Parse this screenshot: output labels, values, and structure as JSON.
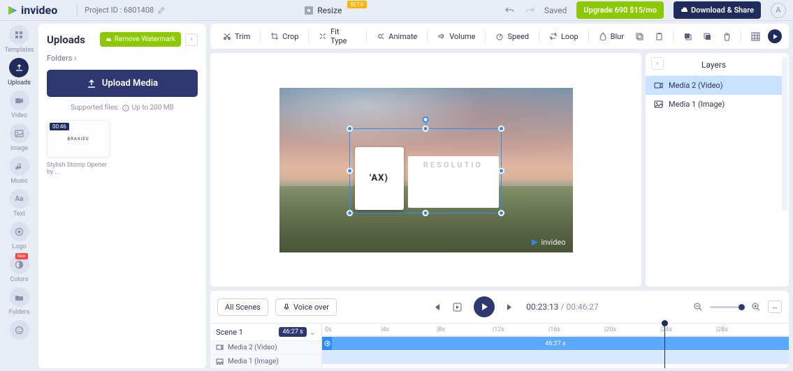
{
  "brand": "invideo",
  "project_id_label": "Project ID : 6801408",
  "resize_label": "Resize",
  "beta_label": "BETA",
  "saved_label": "Saved",
  "upgrade_label": "Upgrade 690 $15/mo",
  "download_label": "Download & Share",
  "avatar_initial": "A",
  "side_rail": [
    {
      "label": "Templates"
    },
    {
      "label": "Uploads"
    },
    {
      "label": "Video"
    },
    {
      "label": "Image"
    },
    {
      "label": "Music"
    },
    {
      "label": "Text"
    },
    {
      "label": "Logo"
    },
    {
      "label": "Colors"
    },
    {
      "label": "Folders"
    }
  ],
  "uploads_panel": {
    "title": "Uploads",
    "remove_wm": "Remove Watermark",
    "folders": "Folders ›",
    "upload_btn": "Upload Media",
    "supported_prefix": "Supported files:",
    "supported_limit": "Up to 200 MB",
    "thumb_duration": "00:46",
    "thumb_inner": "BRAXIEU",
    "thumb_caption": "Stylish Stomp Opener by ..."
  },
  "toolbar": {
    "trim": "Trim",
    "crop": "Crop",
    "fit": "Fit Type",
    "animate": "Animate",
    "volume": "Volume",
    "speed": "Speed",
    "loop": "Loop",
    "blur": "Blur"
  },
  "canvas": {
    "text1": "'AX)",
    "text2": "RESOLUTIO",
    "watermark": "invideo"
  },
  "layers": {
    "title": "Layers",
    "items": [
      {
        "label": "Media 2 (Video)"
      },
      {
        "label": "Media 1 (Image)"
      }
    ]
  },
  "timeline": {
    "all_scenes": "All Scenes",
    "voice_over": "Voice over",
    "current": "00:23:13",
    "total": "00:46:27",
    "scene_label": "Scene 1",
    "scene_duration": "46:27 s",
    "ruler": [
      "0s",
      "|4s",
      "|8s",
      "|12s",
      "|16s",
      "|20s",
      "|24s",
      "|28s"
    ],
    "rows": [
      {
        "label": "Media 2 (Video)",
        "clip_label": "46:27 s"
      },
      {
        "label": "Media 1 (Image)"
      }
    ]
  },
  "new_badge": "New"
}
